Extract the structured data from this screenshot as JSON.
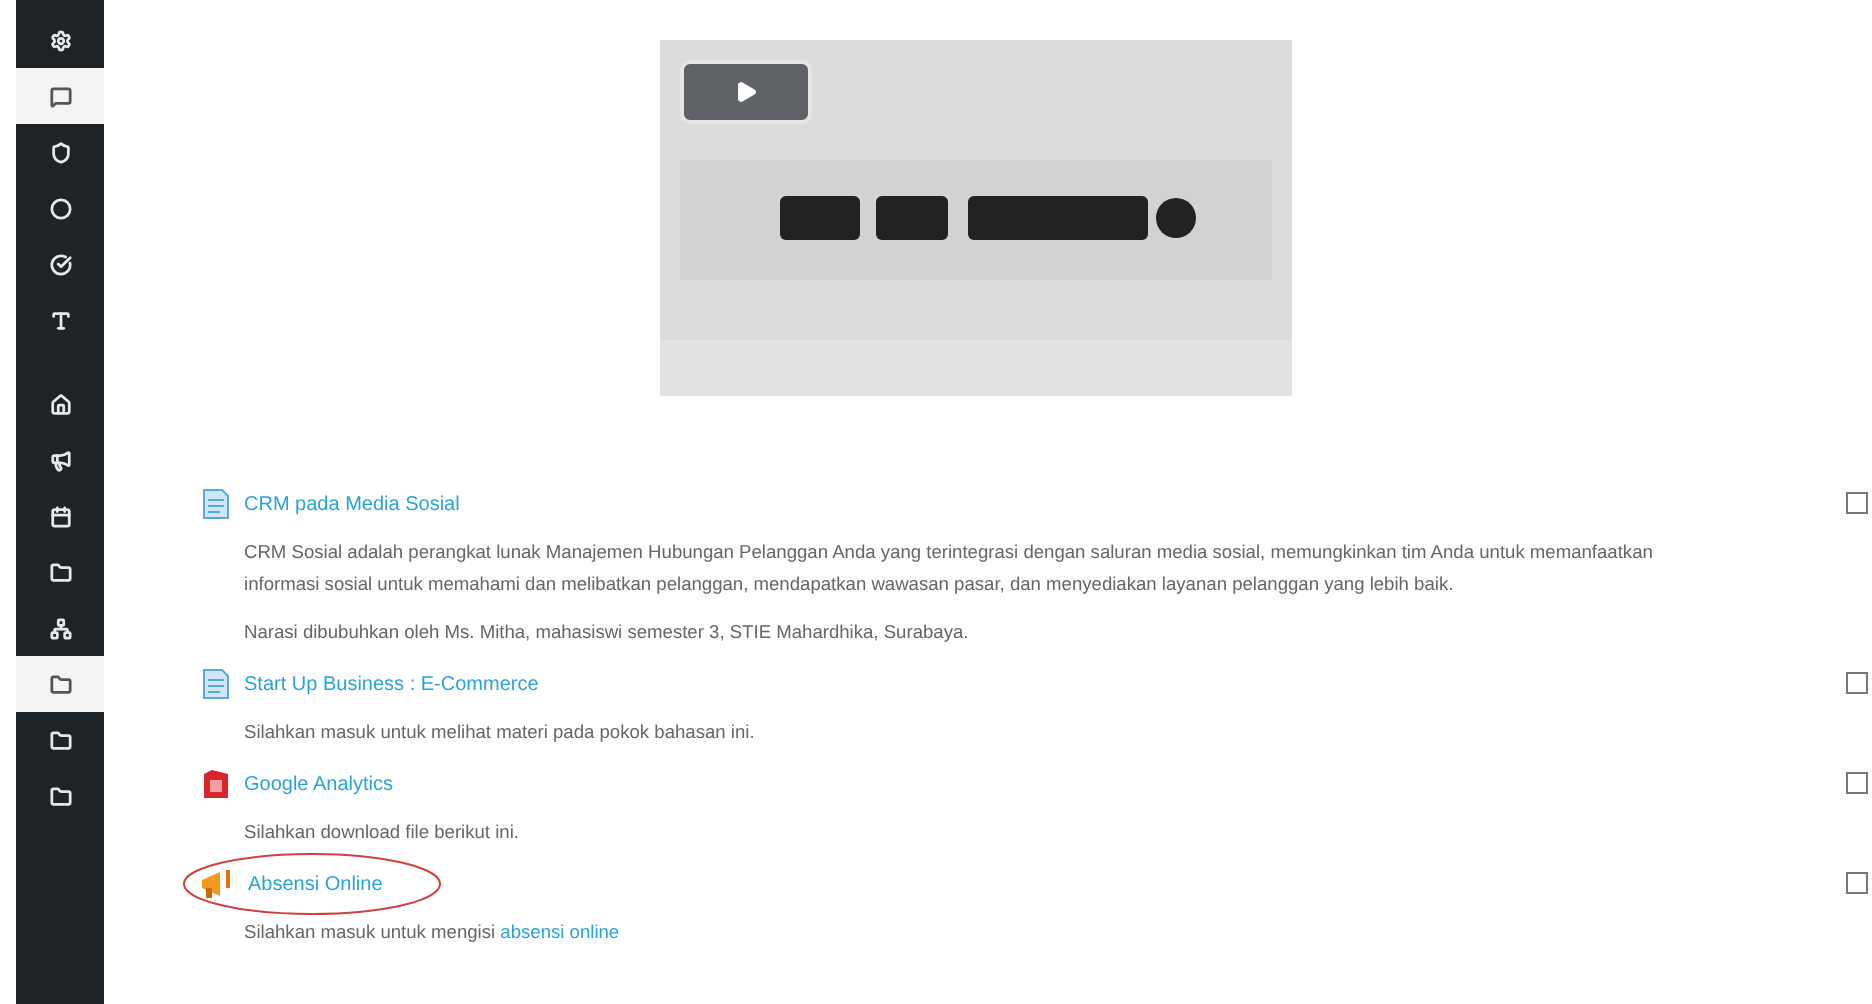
{
  "sidebar": {
    "items": [
      {
        "selected": false
      },
      {
        "selected": true
      },
      {
        "selected": false
      },
      {
        "selected": false
      },
      {
        "selected": false
      },
      {
        "selected": false
      },
      {
        "selected": false
      },
      {
        "selected": false
      },
      {
        "selected": false
      },
      {
        "selected": false
      },
      {
        "selected": false
      },
      {
        "selected": true
      },
      {
        "selected": false
      },
      {
        "selected": false
      }
    ]
  },
  "activities": [
    {
      "kind": "page",
      "title": "CRM pada Media Sosial",
      "circled": false,
      "checked": false,
      "description": [
        {
          "text": "CRM Sosial adalah perangkat lunak Manajemen Hubungan Pelanggan Anda yang terintegrasi dengan saluran media sosial, memungkinkan tim Anda untuk memanfaatkan informasi sosial untuk memahami dan melibatkan pelanggan, mendapatkan wawasan pasar, dan menyediakan layanan pelanggan yang lebih baik."
        },
        {
          "text": "Narasi dibubuhkan oleh Ms. Mitha, mahasiswi semester 3, STIE Mahardhika, Surabaya."
        }
      ]
    },
    {
      "kind": "page",
      "title": "Start Up Business : E-Commerce",
      "circled": false,
      "checked": false,
      "description": [
        {
          "text": "Silahkan masuk untuk melihat materi pada pokok bahasan ini."
        }
      ]
    },
    {
      "kind": "file",
      "title": "Google Analytics",
      "circled": false,
      "checked": false,
      "description": [
        {
          "text": "Silahkan download file berikut ini."
        }
      ]
    },
    {
      "kind": "attendance",
      "title": "Absensi Online",
      "circled": true,
      "checked": false,
      "description": [
        {
          "text": "Silahkan masuk untuk mengisi ",
          "link": "absensi online"
        }
      ]
    }
  ]
}
